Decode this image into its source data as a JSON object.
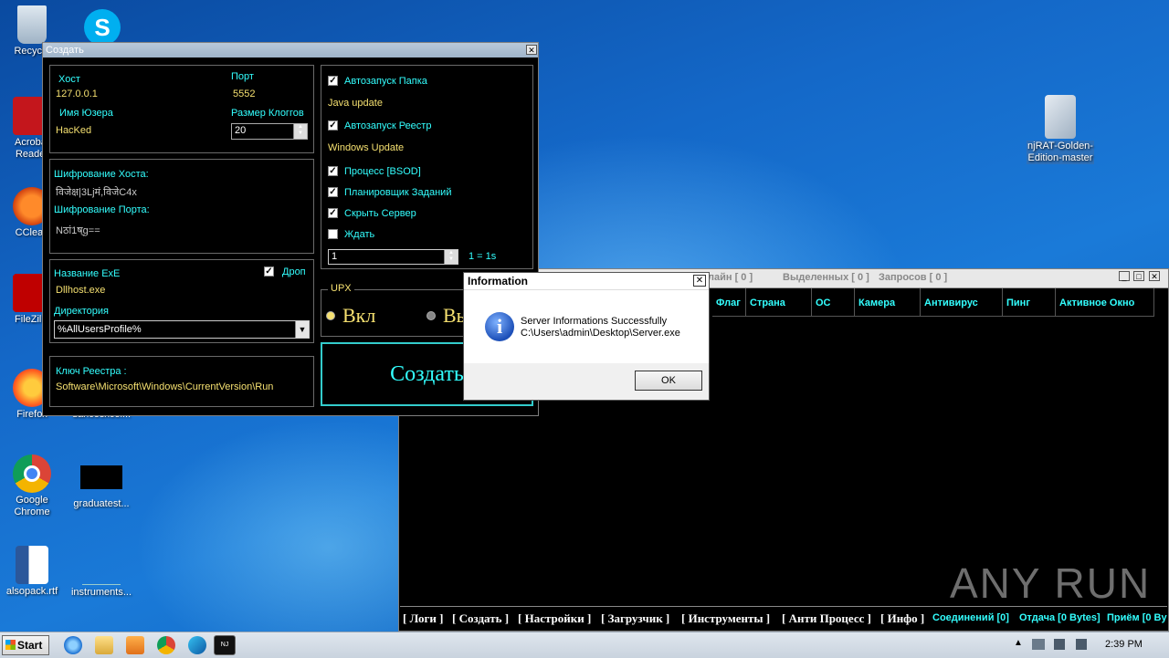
{
  "desktop_icons": [
    {
      "label": "Recycle",
      "icon": "recycle-bin-icon"
    },
    {
      "label": "Acrobat Reader",
      "icon": "acrobat-icon"
    },
    {
      "label": "CClean",
      "icon": "ccleaner-icon"
    },
    {
      "label": "FileZilla",
      "icon": "filezilla-icon"
    },
    {
      "label": "Firefox",
      "icon": "firefox-icon"
    },
    {
      "label": "Google Chrome",
      "icon": "chrome-icon"
    },
    {
      "label": "graduatest...",
      "icon": "file-icon"
    },
    {
      "label": "alsopack.rtf",
      "icon": "word-icon"
    },
    {
      "label": "instruments...",
      "icon": "file-icon"
    },
    {
      "label": "njRAT-Golden-Edition-master",
      "icon": "folder-icon"
    },
    {
      "label": "dancesxcel...",
      "icon": "file-icon"
    }
  ],
  "builder": {
    "title": "Создать",
    "host_label": "Хост",
    "host_value": "127.0.0.1",
    "port_label": "Порт",
    "port_value": "5552",
    "user_label": "Имя Юзера",
    "user_value": "HacKed",
    "log_size_label": "Размер Клоггов",
    "log_size_value": "20",
    "host_enc_label": "Шифрование Хоста:",
    "host_enc_value": "विजेक्ष|3Ljमं,विजेC4x",
    "port_enc_label": "Шифрование Порта:",
    "port_enc_value": "Nठां1ष्g==",
    "exe_name_label": "Название ExE",
    "exe_name_value": "Dllhost.exe",
    "drop_label": "Дроп",
    "dir_label": "Директория",
    "dir_value": "%AllUsersProfile%",
    "reg_key_label": "Ключ Реестра :",
    "reg_key_value": "Software\\Microsoft\\Windows\\CurrentVersion\\Run",
    "autorun_folder_label": "Автозапуск Папка",
    "autorun_folder_value": "Java update",
    "autorun_reg_label": "Автозапуск Реестр",
    "autorun_reg_value": "Windows Update",
    "process_label": "Процесс [BSOD]",
    "scheduler_label": "Планировщик Заданий",
    "hide_label": "Скрыть Сервер",
    "wait_label": "Ждать",
    "wait_value": "1",
    "wait_hint": "1 = 1s",
    "upx_label": "UPX",
    "upx_on": "Вкл",
    "upx_off": "Вы",
    "create_button": "Создать"
  },
  "main": {
    "stats_online": "лайн [ 0 ]",
    "stats_selected": "Выделенных [ 0 ]",
    "stats_requests": "Запросов [ 0 ]",
    "columns": [
      "Флаг",
      "Страна",
      "ОС",
      "Камера",
      "Антивирус",
      "Пинг",
      "Активное Окно"
    ],
    "bottom_menu": [
      "[ Логи ]",
      "[ Создать ]",
      "[ Настройки ]",
      "[ Загрузчик ]",
      "[ Инструменты ]",
      "[ Анти Процесс ]",
      "[ Инфо ]"
    ],
    "status_connections": "Соединений [0]",
    "status_upload": "Отдача [0 Bytes]",
    "status_download": "Приём [0 By"
  },
  "dialog": {
    "title": "Information",
    "message_line1": "Server Informations Successfully",
    "message_line2": "C:\\Users\\admin\\Desktop\\Server.exe",
    "ok": "OK"
  },
  "watermark": "ANY RUN",
  "taskbar": {
    "start": "Start",
    "clock": "2:39 PM"
  }
}
